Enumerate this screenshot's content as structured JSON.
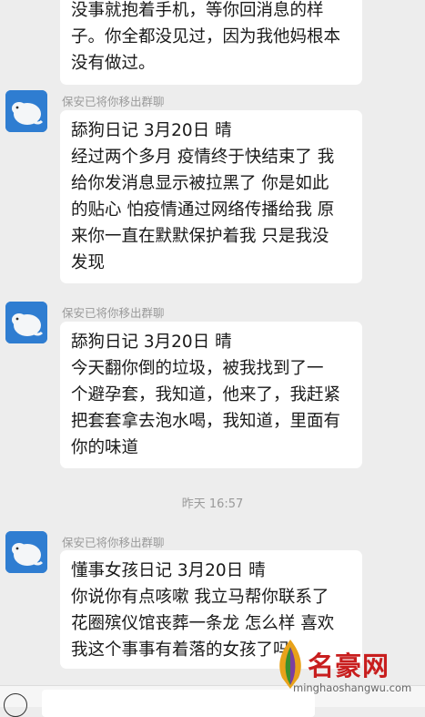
{
  "messages": [
    {
      "lines": [
        "没事就抱着手机，等你回消息的样",
        "子。你全都没见过，因为我他妈根本",
        "没有做过。"
      ]
    },
    {
      "sender": "保安已将你移出群聊",
      "lines": [
        "舔狗日记 3月20日 晴",
        "经过两个多月 疫情终于快结束了 我",
        "给你发消息显示被拉黑了 你是如此",
        "的贴心 怕疫情通过网络传播给我 原",
        "来你一直在默默保护着我 只是我没",
        "发现"
      ]
    },
    {
      "sender": "保安已将你移出群聊",
      "lines": [
        "舔狗日记 3月20日 晴",
        "今天翻你倒的垃圾，被我找到了一",
        "个避孕套，我知道，他来了，我赶紧",
        "把套套拿去泡水喝，我知道，里面有",
        "你的味道"
      ]
    },
    {
      "sender": "保安已将你移出群聊",
      "lines": [
        "懂事女孩日记 3月20日 晴",
        "你说你有点咳嗽 我立马帮你联系了",
        "花圈殡仪馆丧葬一条龙 怎么样 喜欢",
        "我这个事事有着落的女孩了吗"
      ]
    }
  ],
  "timestamp": "昨天 16:57",
  "watermark": {
    "text": "名豪网",
    "url": "minghaoshangwu.com"
  },
  "colors": {
    "background": "#ededed",
    "bubble": "#ffffff",
    "avatar": "#2f7dd1",
    "watermark": "#c81e1e"
  }
}
